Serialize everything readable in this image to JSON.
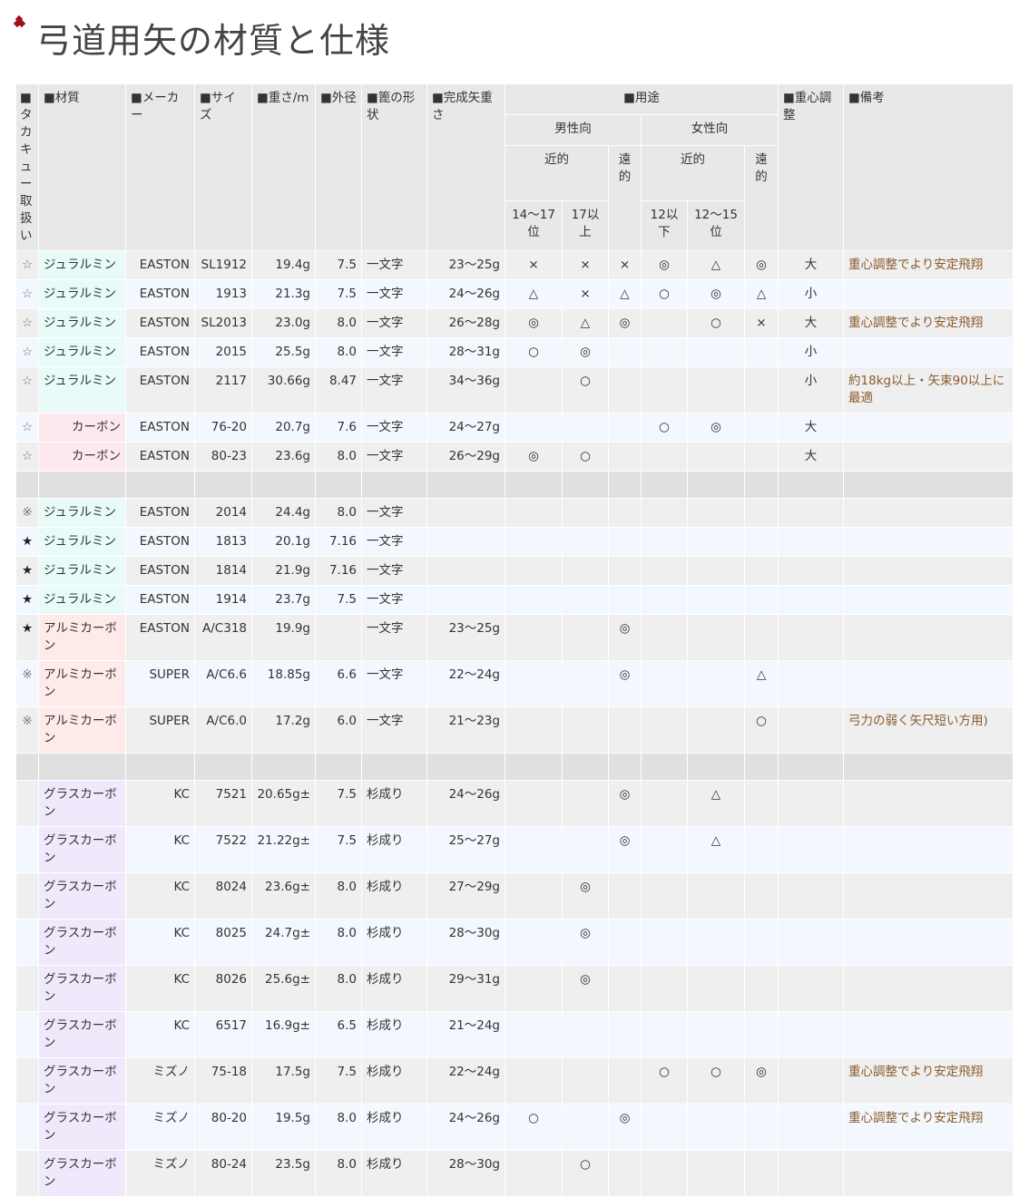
{
  "title": "弓道用矢の材質と仕様",
  "title_icon": "diamond-ornament-icon",
  "headers": {
    "mark": "■タカキュー取扱い",
    "material": "■材質",
    "maker": "■メーカー",
    "size": "■サイズ",
    "weight": "■重さ/m",
    "diameter": "■外径",
    "shape": "■篦の形状",
    "finished_weight": "■完成矢重さ",
    "usage": "■用途",
    "male": "男性向",
    "female": "女性向",
    "near": "近的",
    "far": "遠的",
    "male_near_a": "14〜17位",
    "male_near_b": "17以上",
    "female_near_a": "12以下",
    "female_near_b": "12〜15位",
    "balance": "■重心調整",
    "notes": "■備考"
  },
  "rows": [
    {
      "mark": "☆",
      "material": "ジュラルミン",
      "mat": "dura",
      "maker": "EASTON",
      "size": "SL1912",
      "weight": "19.4g",
      "diameter": "7.5",
      "shape": "一文字",
      "finished": "23〜25g",
      "m1": "×",
      "m2": "×",
      "m3": "×",
      "f1": "◎",
      "f2": "△",
      "f3": "◎",
      "balance": "大",
      "note": "重心調整でより安定飛翔"
    },
    {
      "mark": "☆",
      "material": "ジュラルミン",
      "mat": "dura",
      "maker": "EASTON",
      "size": "1913",
      "weight": "21.3g",
      "diameter": "7.5",
      "shape": "一文字",
      "finished": "24〜26g",
      "m1": "△",
      "m2": "×",
      "m3": "△",
      "f1": "○",
      "f2": "◎",
      "f3": "△",
      "balance": "小",
      "note": ""
    },
    {
      "mark": "☆",
      "material": "ジュラルミン",
      "mat": "dura",
      "maker": "EASTON",
      "size": "SL2013",
      "weight": "23.0g",
      "diameter": "8.0",
      "shape": "一文字",
      "finished": "26〜28g",
      "m1": "◎",
      "m2": "△",
      "m3": "◎",
      "f1": "",
      "f2": "○",
      "f3": "×",
      "balance": "大",
      "note": "重心調整でより安定飛翔"
    },
    {
      "mark": "☆",
      "material": "ジュラルミン",
      "mat": "dura",
      "maker": "EASTON",
      "size": "2015",
      "weight": "25.5g",
      "diameter": "8.0",
      "shape": "一文字",
      "finished": "28〜31g",
      "m1": "○",
      "m2": "◎",
      "m3": "",
      "f1": "",
      "f2": "",
      "f3": "",
      "balance": "小",
      "note": ""
    },
    {
      "mark": "☆",
      "material": "ジュラルミン",
      "mat": "dura",
      "maker": "EASTON",
      "size": "2117",
      "weight": "30.66g",
      "diameter": "8.47",
      "shape": "一文字",
      "finished": "34〜36g",
      "m1": "",
      "m2": "○",
      "m3": "",
      "f1": "",
      "f2": "",
      "f3": "",
      "balance": "小",
      "note": "約18kg以上・矢束90以上に最適"
    },
    {
      "mark": "☆",
      "material": "カーボン",
      "mat": "carbon",
      "maker": "EASTON",
      "size": "76-20",
      "weight": "20.7g",
      "diameter": "7.6",
      "shape": "一文字",
      "finished": "24〜27g",
      "m1": "",
      "m2": "",
      "m3": "",
      "f1": "○",
      "f2": "◎",
      "f3": "",
      "balance": "大",
      "note": ""
    },
    {
      "mark": "☆",
      "material": "カーボン",
      "mat": "carbon",
      "maker": "EASTON",
      "size": "80-23",
      "weight": "23.6g",
      "diameter": "8.0",
      "shape": "一文字",
      "finished": "26〜29g",
      "m1": "◎",
      "m2": "○",
      "m3": "",
      "f1": "",
      "f2": "",
      "f3": "",
      "balance": "大",
      "note": ""
    },
    {
      "sep": true
    },
    {
      "mark": "※",
      "material": "ジュラルミン",
      "mat": "dura",
      "maker": "EASTON",
      "size": "2014",
      "weight": "24.4g",
      "diameter": "8.0",
      "shape": "一文字",
      "finished": "",
      "m1": "",
      "m2": "",
      "m3": "",
      "f1": "",
      "f2": "",
      "f3": "",
      "balance": "",
      "note": ""
    },
    {
      "mark": "★",
      "material": "ジュラルミン",
      "mat": "dura",
      "maker": "EASTON",
      "size": "1813",
      "weight": "20.1g",
      "diameter": "7.16",
      "shape": "一文字",
      "finished": "",
      "m1": "",
      "m2": "",
      "m3": "",
      "f1": "",
      "f2": "",
      "f3": "",
      "balance": "",
      "note": ""
    },
    {
      "mark": "★",
      "material": "ジュラルミン",
      "mat": "dura",
      "maker": "EASTON",
      "size": "1814",
      "weight": "21.9g",
      "diameter": "7.16",
      "shape": "一文字",
      "finished": "",
      "m1": "",
      "m2": "",
      "m3": "",
      "f1": "",
      "f2": "",
      "f3": "",
      "balance": "",
      "note": ""
    },
    {
      "mark": "★",
      "material": "ジュラルミン",
      "mat": "dura",
      "maker": "EASTON",
      "size": "1914",
      "weight": "23.7g",
      "diameter": "7.5",
      "shape": "一文字",
      "finished": "",
      "m1": "",
      "m2": "",
      "m3": "",
      "f1": "",
      "f2": "",
      "f3": "",
      "balance": "",
      "note": ""
    },
    {
      "mark": "★",
      "material": "アルミカーボン",
      "mat": "alu",
      "maker": "EASTON",
      "size": "A/C318",
      "weight": "19.9g",
      "diameter": "",
      "shape": "一文字",
      "finished": "23〜25g",
      "m1": "",
      "m2": "",
      "m3": "◎",
      "f1": "",
      "f2": "",
      "f3": "",
      "balance": "",
      "note": ""
    },
    {
      "mark": "※",
      "material": "アルミカーボン",
      "mat": "alu",
      "maker": "SUPER",
      "size": "A/C6.6",
      "weight": "18.85g",
      "diameter": "6.6",
      "shape": "一文字",
      "finished": "22〜24g",
      "m1": "",
      "m2": "",
      "m3": "◎",
      "f1": "",
      "f2": "",
      "f3": "△",
      "balance": "",
      "note": ""
    },
    {
      "mark": "※",
      "material": "アルミカーボン",
      "mat": "alu",
      "maker": "SUPER",
      "size": "A/C6.0",
      "weight": "17.2g",
      "diameter": "6.0",
      "shape": "一文字",
      "finished": "21〜23g",
      "m1": "",
      "m2": "",
      "m3": "",
      "f1": "",
      "f2": "",
      "f3": "○",
      "balance": "",
      "note": "弓力の弱く矢尺短い方用)"
    },
    {
      "sep": true
    },
    {
      "mark": "",
      "material": "グラスカーボン",
      "mat": "glass",
      "maker": "KC",
      "size": "7521",
      "weight": "20.65g±",
      "diameter": "7.5",
      "shape": "杉成り",
      "finished": "24〜26g",
      "m1": "",
      "m2": "",
      "m3": "◎",
      "f1": "",
      "f2": "△",
      "f3": "",
      "balance": "",
      "note": ""
    },
    {
      "mark": "",
      "material": "グラスカーボン",
      "mat": "glass",
      "maker": "KC",
      "size": "7522",
      "weight": "21.22g±",
      "diameter": "7.5",
      "shape": "杉成り",
      "finished": "25〜27g",
      "m1": "",
      "m2": "",
      "m3": "◎",
      "f1": "",
      "f2": "△",
      "f3": "",
      "balance": "",
      "note": ""
    },
    {
      "mark": "",
      "material": "グラスカーボン",
      "mat": "glass",
      "maker": "KC",
      "size": "8024",
      "weight": "23.6g±",
      "diameter": "8.0",
      "shape": "杉成り",
      "finished": "27〜29g",
      "m1": "",
      "m2": "◎",
      "m3": "",
      "f1": "",
      "f2": "",
      "f3": "",
      "balance": "",
      "note": ""
    },
    {
      "mark": "",
      "material": "グラスカーボン",
      "mat": "glass",
      "maker": "KC",
      "size": "8025",
      "weight": "24.7g±",
      "diameter": "8.0",
      "shape": "杉成り",
      "finished": "28〜30g",
      "m1": "",
      "m2": "◎",
      "m3": "",
      "f1": "",
      "f2": "",
      "f3": "",
      "balance": "",
      "note": ""
    },
    {
      "mark": "",
      "material": "グラスカーボン",
      "mat": "glass",
      "maker": "KC",
      "size": "8026",
      "weight": "25.6g±",
      "diameter": "8.0",
      "shape": "杉成り",
      "finished": "29〜31g",
      "m1": "",
      "m2": "◎",
      "m3": "",
      "f1": "",
      "f2": "",
      "f3": "",
      "balance": "",
      "note": ""
    },
    {
      "mark": "",
      "material": "グラスカーボン",
      "mat": "glass",
      "maker": "KC",
      "size": "6517",
      "weight": "16.9g±",
      "diameter": "6.5",
      "shape": "杉成り",
      "finished": "21〜24g",
      "m1": "",
      "m2": "",
      "m3": "",
      "f1": "",
      "f2": "",
      "f3": "",
      "balance": "",
      "note": ""
    },
    {
      "mark": "",
      "material": "グラスカーボン",
      "mat": "glass",
      "maker": "ミズノ",
      "size": "75-18",
      "weight": "17.5g",
      "diameter": "7.5",
      "shape": "杉成り",
      "finished": "22〜24g",
      "m1": "",
      "m2": "",
      "m3": "",
      "f1": "○",
      "f2": "○",
      "f3": "◎",
      "balance": "",
      "note": "重心調整でより安定飛翔"
    },
    {
      "mark": "",
      "material": "グラスカーボン",
      "mat": "glass",
      "maker": "ミズノ",
      "size": "80-20",
      "weight": "19.5g",
      "diameter": "8.0",
      "shape": "杉成り",
      "finished": "24〜26g",
      "m1": "○",
      "m2": "",
      "m3": "◎",
      "f1": "",
      "f2": "",
      "f3": "",
      "balance": "",
      "note": "重心調整でより安定飛翔"
    },
    {
      "mark": "",
      "material": "グラスカーボン",
      "mat": "glass",
      "maker": "ミズノ",
      "size": "80-24",
      "weight": "23.5g",
      "diameter": "8.0",
      "shape": "杉成り",
      "finished": "28〜30g",
      "m1": "",
      "m2": "○",
      "m3": "",
      "f1": "",
      "f2": "",
      "f3": "",
      "balance": "",
      "note": ""
    }
  ]
}
